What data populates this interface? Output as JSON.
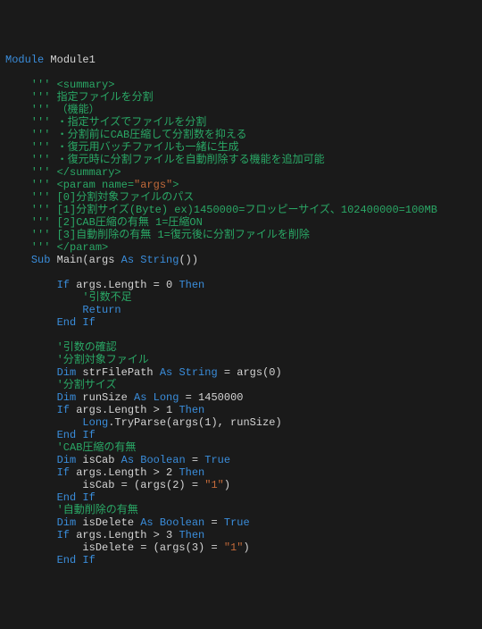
{
  "code": {
    "l1_kw1": "Module",
    "l1_id": " Module1",
    "l3": "    ''' <summary>",
    "l4": "    ''' 指定ファイルを分割",
    "l5": "    ''' （機能）",
    "l6": "    ''' ・指定サイズでファイルを分割",
    "l7": "    ''' ・分割前にCAB圧縮して分割数を抑える",
    "l8": "    ''' ・復元用バッチファイルも一緒に生成",
    "l9": "    ''' ・復元時に分割ファイルを自動削除する機能を追加可能",
    "l10": "    ''' </summary>",
    "l11a": "    ''' <param name=",
    "l11s": "\"args\"",
    "l11b": ">",
    "l12": "    ''' [0]分割対象ファイルのパス",
    "l13": "    ''' [1]分割サイズ(Byte) ex)1450000=フロッピーサイズ、102400000=100MB",
    "l14": "    ''' [2]CAB圧縮の有無 1=圧縮ON",
    "l15": "    ''' [3]自動削除の有無 1=復元後に分割ファイルを削除",
    "l16": "    ''' </param>",
    "l17a": "    ",
    "l17kw1": "Sub",
    "l17b": " Main(args ",
    "l17kw2": "As",
    "l17c": " ",
    "l17kw3": "String",
    "l17d": "())",
    "l19a": "        ",
    "l19kw1": "If",
    "l19b": " args.Length = 0 ",
    "l19kw2": "Then",
    "l20": "            '引数不足",
    "l21a": "            ",
    "l21kw": "Return",
    "l22a": "        ",
    "l22kw": "End If",
    "l24": "        '引数の確認",
    "l25": "        '分割対象ファイル",
    "l26a": "        ",
    "l26kw1": "Dim",
    "l26b": " strFilePath ",
    "l26kw2": "As",
    "l26c": " ",
    "l26kw3": "String",
    "l26d": " = args(0)",
    "l27": "        '分割サイズ",
    "l28a": "        ",
    "l28kw1": "Dim",
    "l28b": " runSize ",
    "l28kw2": "As",
    "l28c": " ",
    "l28kw3": "Long",
    "l28d": " = 1450000",
    "l29a": "        ",
    "l29kw1": "If",
    "l29b": " args.Length > 1 ",
    "l29kw2": "Then",
    "l30a": "            ",
    "l30kw": "Long",
    "l30b": ".TryParse(args(1), runSize)",
    "l31a": "        ",
    "l31kw": "End If",
    "l32": "        'CAB圧縮の有無",
    "l33a": "        ",
    "l33kw1": "Dim",
    "l33b": " isCab ",
    "l33kw2": "As",
    "l33c": " ",
    "l33kw3": "Boolean",
    "l33d": " = ",
    "l33kw4": "True",
    "l34a": "        ",
    "l34kw1": "If",
    "l34b": " args.Length > 2 ",
    "l34kw2": "Then",
    "l35a": "            isCab = (args(2) = ",
    "l35s": "\"1\"",
    "l35b": ")",
    "l36a": "        ",
    "l36kw": "End If",
    "l37": "        '自動削除の有無",
    "l38a": "        ",
    "l38kw1": "Dim",
    "l38b": " isDelete ",
    "l38kw2": "As",
    "l38c": " ",
    "l38kw3": "Boolean",
    "l38d": " = ",
    "l38kw4": "True",
    "l39a": "        ",
    "l39kw1": "If",
    "l39b": " args.Length > 3 ",
    "l39kw2": "Then",
    "l40a": "            isDelete = (args(3) = ",
    "l40s": "\"1\"",
    "l40b": ")",
    "l41a": "        ",
    "l41kw": "End If"
  }
}
